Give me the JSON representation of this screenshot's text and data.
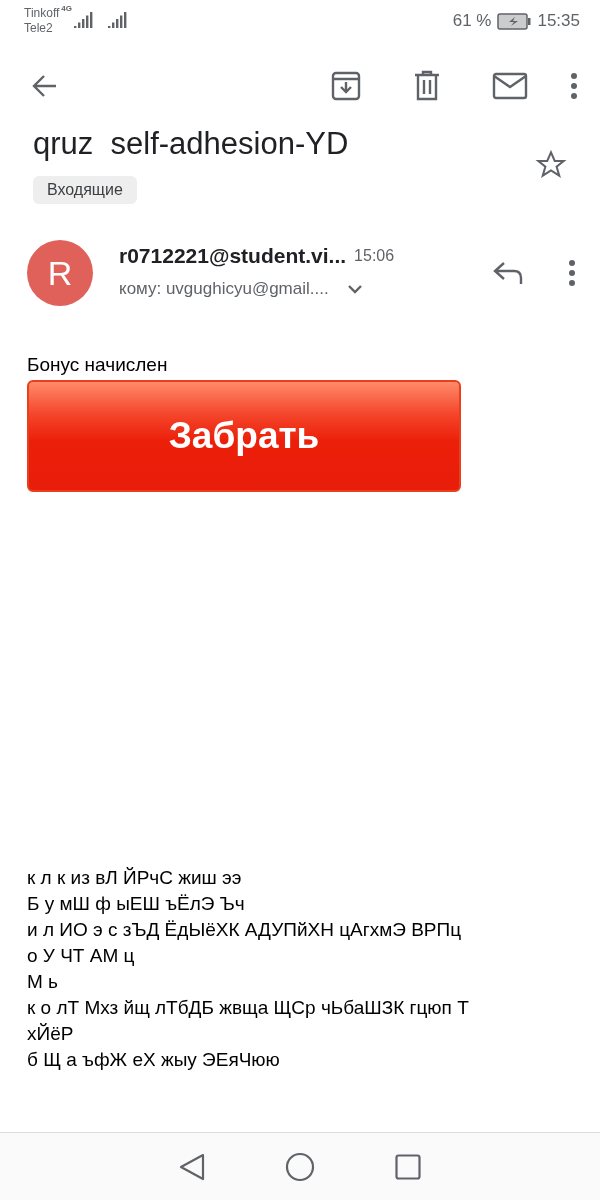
{
  "status_bar": {
    "carriers": [
      "Tinkoff",
      "Tele2"
    ],
    "network": "4G",
    "battery": "61 %",
    "time": "15:35"
  },
  "subject": "qruz  self-adhesion-YD",
  "label": "Входящие",
  "starred": false,
  "message": {
    "avatar": "R",
    "sender": "r0712221@student.vi...",
    "time": "15:06",
    "recipient": "кому: uvgughicyu@gmail...."
  },
  "body": {
    "intro": "Бонус начислен",
    "button": "Забрать",
    "lines": [
      "к л к из вЛ ЙРчС жиш ээ",
      "Б у мШ ф ыЕШ ъЁлЭ Ъч",
      "и л ИО э с зЪД ЁдЫёХК АДУПйХН цАгхмЭ ВРПц",
      "о У ЧТ АМ ц",
      "М ь",
      "к о лТ Мхз йщ лТбДБ жвща ЩСр чЬбаШЗК гцюп Т",
      "хЙёР",
      "б Щ а ъфЖ еХ жыу ЭЕяЧюю"
    ]
  }
}
